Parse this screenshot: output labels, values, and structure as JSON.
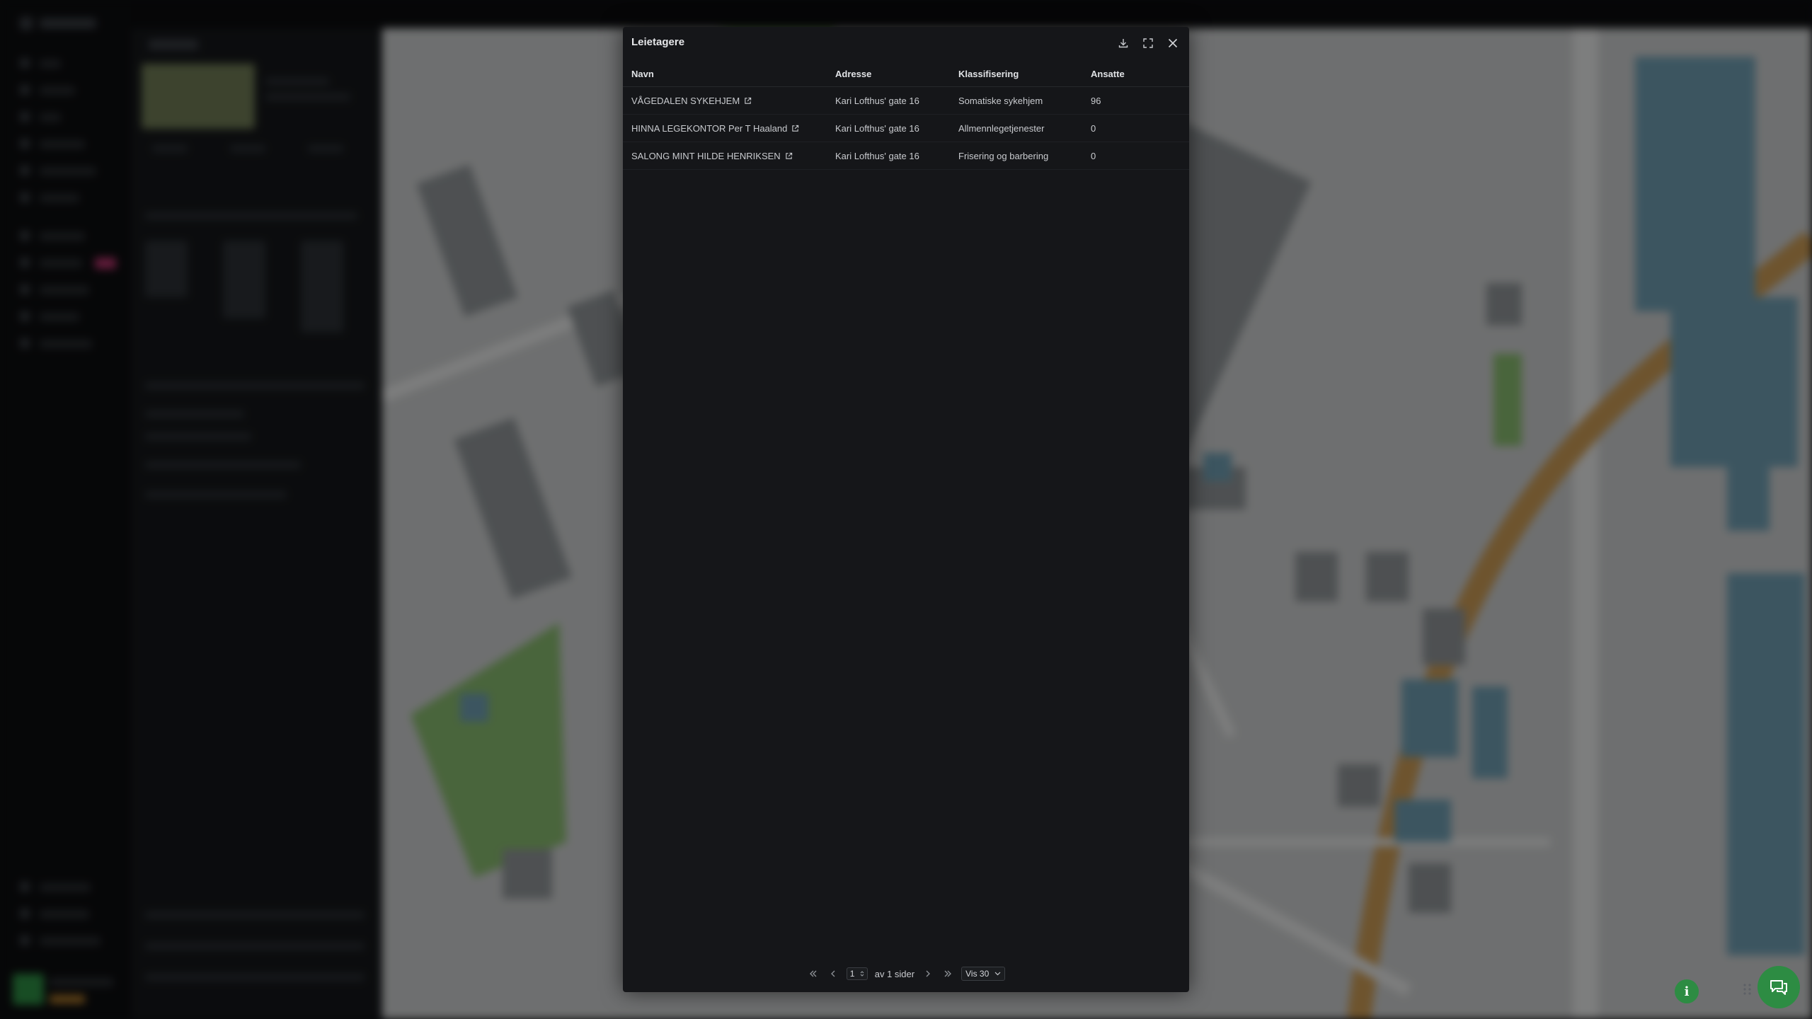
{
  "modal": {
    "title": "Leietagere",
    "download_icon": "download-icon",
    "expand_icon": "expand-icon",
    "close_icon": "close-icon"
  },
  "table": {
    "columns": [
      "Navn",
      "Adresse",
      "Klassifisering",
      "Ansatte"
    ],
    "rows": [
      {
        "navn": "VÅGEDALEN SYKEHJEM",
        "adresse": "Kari Lofthus' gate 16",
        "klassifisering": "Somatiske sykehjem",
        "ansatte": "96"
      },
      {
        "navn": "HINNA LEGEKONTOR Per T Haaland",
        "adresse": "Kari Lofthus' gate 16",
        "klassifisering": "Allmennlegetjenester",
        "ansatte": "0"
      },
      {
        "navn": "SALONG MINT HILDE HENRIKSEN",
        "adresse": "Kari Lofthus' gate 16",
        "klassifisering": "Frisering og barbering",
        "ansatte": "0"
      }
    ]
  },
  "pagination": {
    "page": "1",
    "of_pages": "av 1 sider",
    "page_size": "Vis 30"
  },
  "colors": {
    "accent_green": "#2d8c43",
    "modal_bg": "#151619"
  }
}
